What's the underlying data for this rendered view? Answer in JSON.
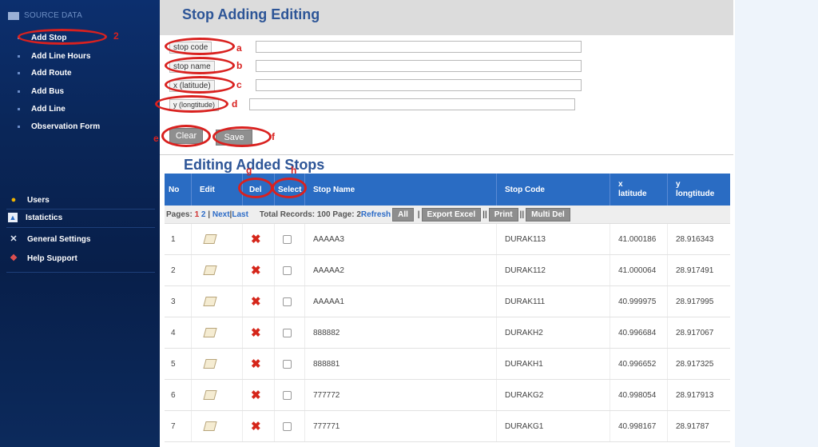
{
  "sidebar": {
    "section_title": "SOURCE DATA",
    "items": [
      {
        "label": "Add Stop"
      },
      {
        "label": "Add Line Hours"
      },
      {
        "label": "Add Route"
      },
      {
        "label": "Add Bus"
      },
      {
        "label": "Add Line"
      },
      {
        "label": "Observation Form"
      }
    ],
    "bottom_items": [
      {
        "label": "Users",
        "icon": "users-icon"
      },
      {
        "label": "Istatictics",
        "icon": "chart-icon"
      },
      {
        "label": "General Settings",
        "icon": "tools-icon"
      },
      {
        "label": "Help Support",
        "icon": "lifebuoy-icon"
      }
    ]
  },
  "main": {
    "title": "Stop Adding Editing",
    "form": {
      "labels": [
        "stop code",
        "stop name",
        "x (latitude)",
        "y (longtitude)"
      ],
      "values": [
        "",
        "",
        "",
        ""
      ],
      "clear_label": "Clear",
      "save_label": "Save"
    },
    "section_title": "Editing Added Stops",
    "table": {
      "columns": [
        "No",
        "Edit",
        "Del",
        "Select",
        "Stop Name",
        "Stop Code",
        "x latitude",
        "y longtitude"
      ],
      "col_x_top": "x",
      "col_x_bottom": "latitude",
      "col_y_top": "y",
      "col_y_bottom": "longtitude",
      "pager": {
        "pages_label": "Pages:",
        "page1": "1",
        "page2": "2",
        "sep": "|",
        "next": "Next",
        "last": "Last",
        "total_text": "Total Records: 100 Page: 2",
        "refresh": "Refresh",
        "all": "All",
        "export": "Export Excel",
        "print": "Print",
        "multi_del": "Multi Del"
      },
      "rows": [
        {
          "no": "1",
          "name": "AAAAA3",
          "code": "DURAK113",
          "x": "41.000186",
          "y": "28.916343"
        },
        {
          "no": "2",
          "name": "AAAAA2",
          "code": "DURAK112",
          "x": "41.000064",
          "y": "28.917491"
        },
        {
          "no": "3",
          "name": "AAAAA1",
          "code": "DURAK111",
          "x": "40.999975",
          "y": "28.917995"
        },
        {
          "no": "4",
          "name": "888882",
          "code": "DURAKH2",
          "x": "40.996684",
          "y": "28.917067"
        },
        {
          "no": "5",
          "name": "888881",
          "code": "DURAKH1",
          "x": "40.996652",
          "y": "28.917325"
        },
        {
          "no": "6",
          "name": "777772",
          "code": "DURAKG2",
          "x": "40.998054",
          "y": "28.917913"
        },
        {
          "no": "7",
          "name": "777771",
          "code": "DURAKG1",
          "x": "40.998167",
          "y": "28.91787"
        }
      ]
    }
  },
  "annotations": {
    "a": "a",
    "b": "b",
    "c": "c",
    "d": "d",
    "e": "e",
    "f": "f",
    "g": "g",
    "h": "h",
    "two": "2"
  },
  "colors": {
    "sidebar_bg": "#0a2658",
    "title_blue": "#2d5597",
    "header_blue": "#2a6cc3",
    "annotation_red": "#d9211f"
  }
}
